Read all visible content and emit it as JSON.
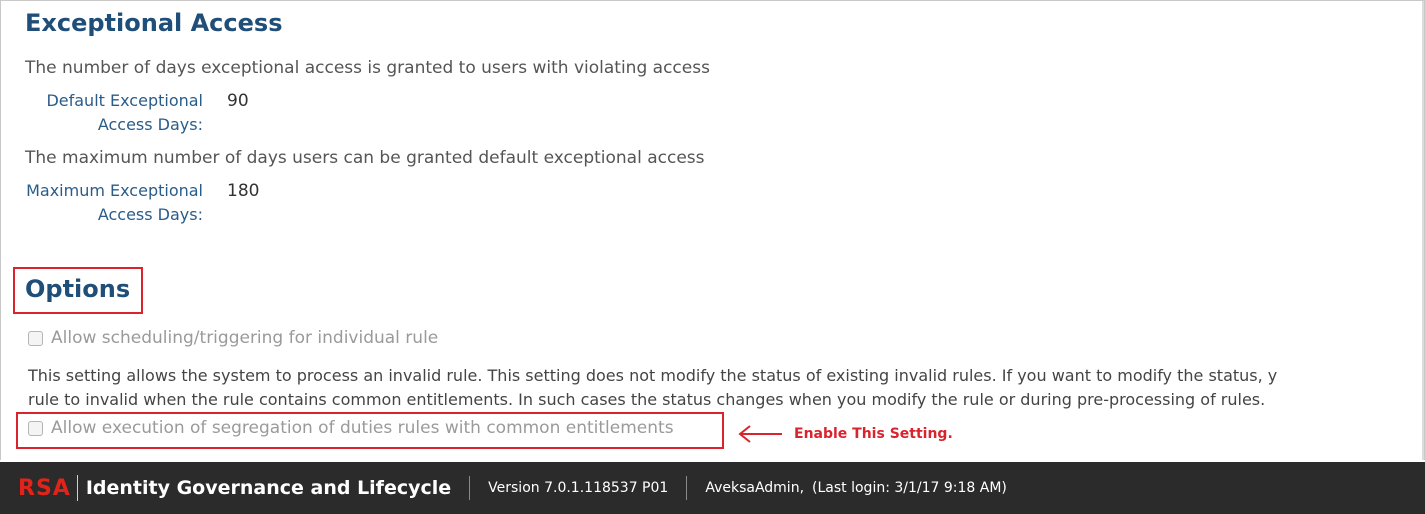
{
  "exceptional_access": {
    "title": "Exceptional Access",
    "desc_default": "The number of days exceptional access is granted to users with violating access",
    "default_days_label": "Default Exceptional Access Days:",
    "default_days_value": "90",
    "desc_max": "The maximum number of days users can be granted default exceptional access",
    "max_days_label": "Maximum Exceptional Access Days:",
    "max_days_value": "180"
  },
  "options": {
    "title": "Options",
    "scheduling_checkbox_label": "Allow scheduling/triggering for individual rule",
    "scheduling_checked": false,
    "help_line1": "This setting allows the system to process an invalid rule. This setting does not modify the status of existing invalid rules. If you want to modify the status, y",
    "help_line2": "rule to invalid when the rule contains common entitlements. In such cases the status changes when you modify the rule or during pre-processing of rules.",
    "sod_checkbox_label": "Allow execution of segregation of duties rules with common entitlements",
    "sod_checked": false
  },
  "annotation": {
    "text": "Enable This Setting."
  },
  "footer": {
    "logo_text": "RSA",
    "product_name": "Identity Governance and Lifecycle",
    "version": "Version 7.0.1.118537 P01",
    "user": "AveksaAdmin,",
    "last_login": "(Last login: 3/1/17 9:18 AM)"
  },
  "colors": {
    "heading": "#1f4e79",
    "label": "#2a5c8a",
    "highlight": "#d9232d",
    "footer_bg": "#2b2b2b"
  }
}
